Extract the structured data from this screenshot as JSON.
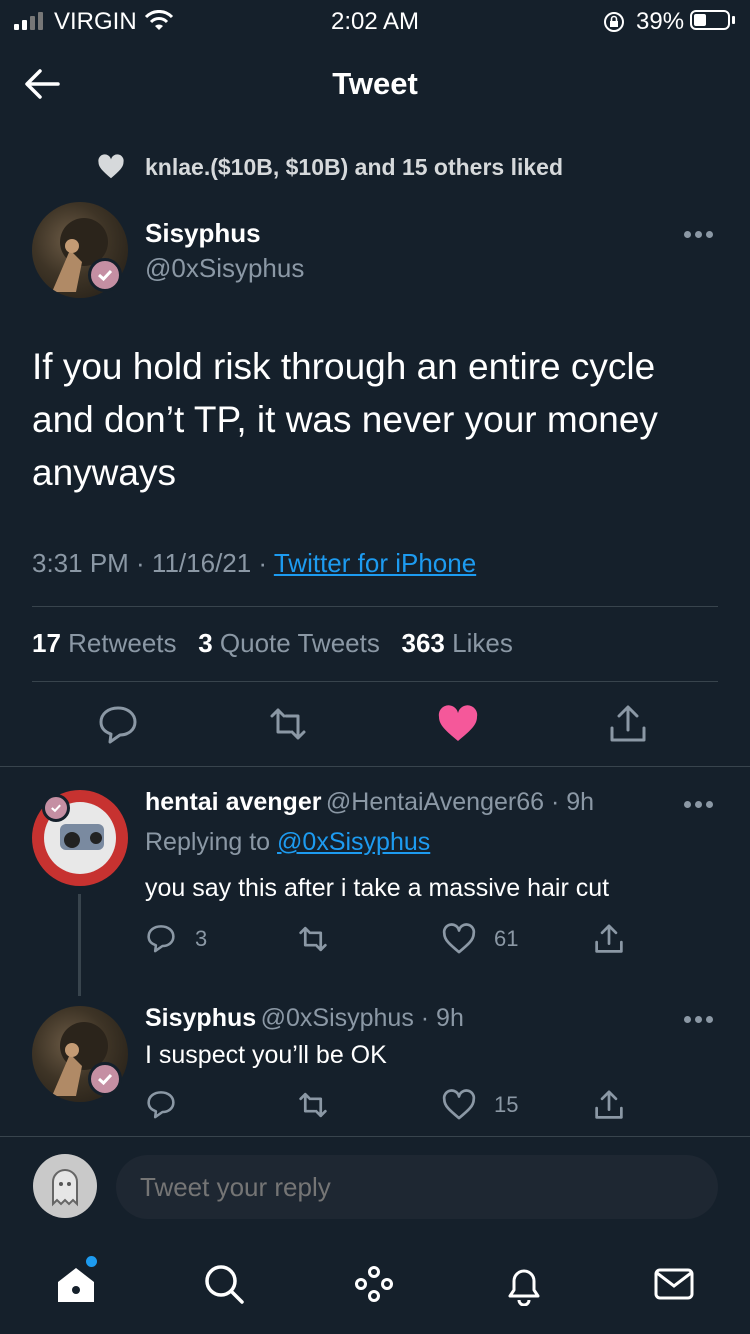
{
  "status_bar": {
    "carrier": "VIRGIN",
    "time": "2:02 AM",
    "battery": "39%",
    "battery_level": 0.39
  },
  "nav": {
    "title": "Tweet"
  },
  "social_context": {
    "text": "knlae.($10B, $10B) and 15 others liked"
  },
  "tweet": {
    "author_name": "Sisyphus",
    "author_handle": "@0xSisyphus",
    "text": "If you hold risk through an entire cycle and don’t TP, it was never your money anyways",
    "timestamp": "3:31 PM · 11/16/21 · ",
    "source": "Twitter for iPhone",
    "stats": {
      "retweets_count": "17",
      "retweets_label": " Retweets",
      "quotes_count": "3",
      "quotes_label": " Quote Tweets",
      "likes_count": "363",
      "likes_label": " Likes"
    },
    "liked": true,
    "colors": {
      "like": "#f91880",
      "link": "#1d9bf0",
      "background": "#15202b"
    }
  },
  "replies": [
    {
      "name": "hentai avenger",
      "meta": "@HentaiAvenger66 · 9h",
      "replying_prefix": "Replying to ",
      "replying_to": "@0xSisyphus",
      "text": "you say this after i take a massive hair cut",
      "reply_count": "3",
      "like_count": "61"
    },
    {
      "name": "Sisyphus",
      "meta": "@0xSisyphus · 9h",
      "text": "I suspect you’ll be OK",
      "like_count": "15"
    }
  ],
  "composer": {
    "placeholder": "Tweet your reply"
  },
  "tab_bar": {
    "icons": [
      "home-icon",
      "search-icon",
      "spaces-icon",
      "notifications-icon",
      "messages-icon"
    ]
  }
}
